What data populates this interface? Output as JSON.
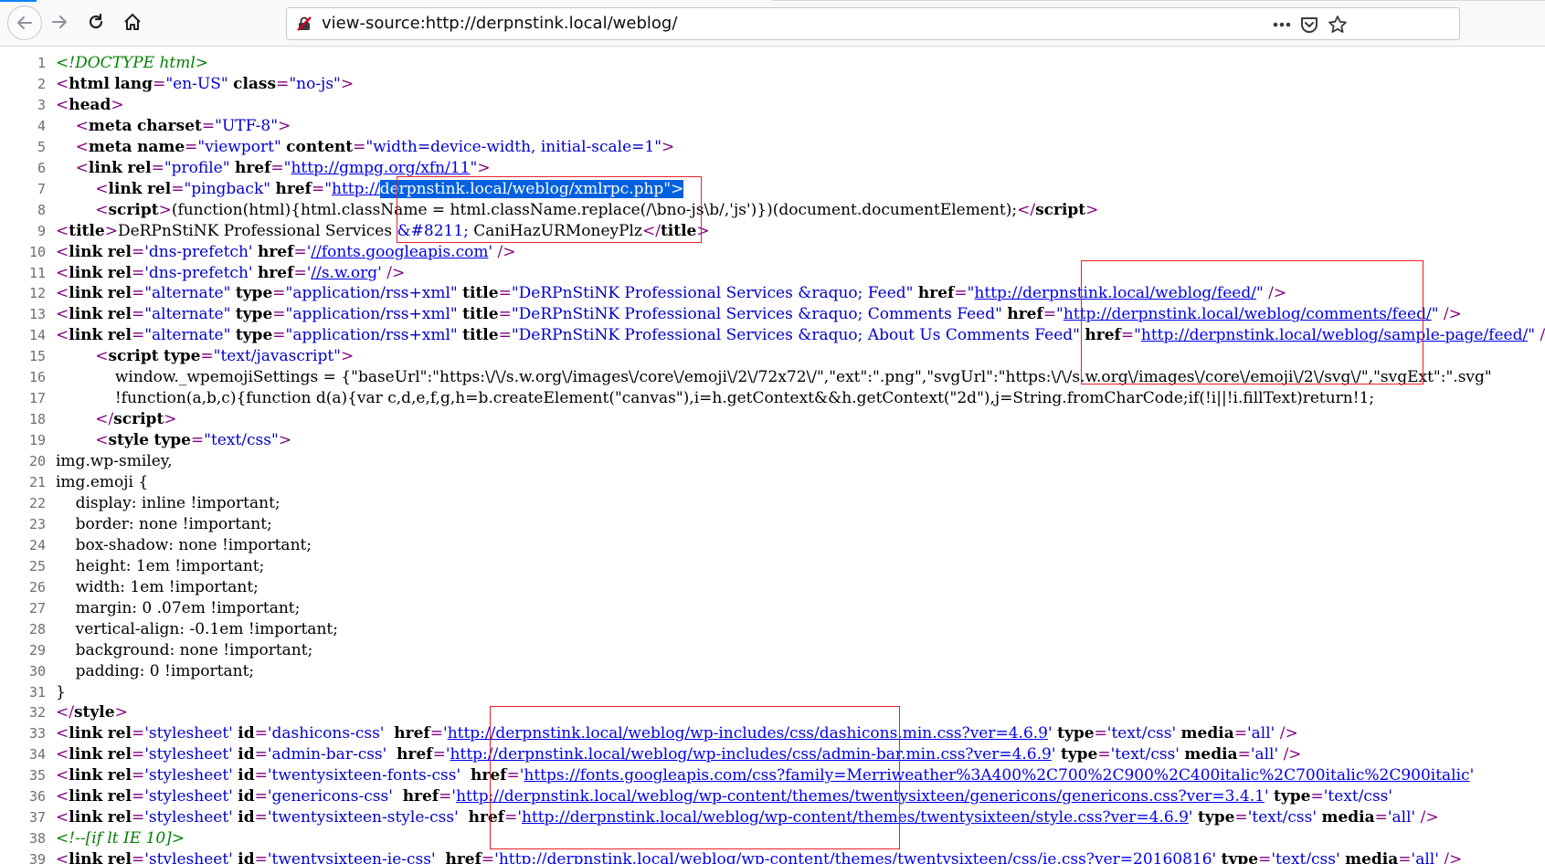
{
  "browser": {
    "url": "view-source:http://derpnstink.local/weblog/",
    "nav_icons": [
      "back-arrow-icon",
      "forward-arrow-icon",
      "reload-icon",
      "home-icon"
    ],
    "url_icons": [
      "insecure-connection-icon",
      "more-actions-icon",
      "pocket-icon",
      "bookmark-star-icon"
    ]
  },
  "source_lines": [
    {
      "n": "1",
      "html": "<span class='cm'>&lt;!DOCTYPE html&gt;</span>"
    },
    {
      "n": "2",
      "html": "<span class='t'>&lt;<span class='a'>html</span> <span class='a'>lang</span>=<span class='v'>\"en-US\"</span> <span class='a'>class</span>=<span class='v'>\"no-js\"</span>&gt;</span>"
    },
    {
      "n": "3",
      "html": "<span class='t'>&lt;<span class='a'>head</span>&gt;</span>"
    },
    {
      "n": "4",
      "html": "    <span class='t'>&lt;<span class='a'>meta</span> <span class='a'>charset</span>=<span class='v'>\"UTF-8\"</span>&gt;</span>"
    },
    {
      "n": "5",
      "html": "    <span class='t'>&lt;<span class='a'>meta</span> <span class='a'>name</span>=<span class='v'>\"viewport\"</span> <span class='a'>content</span>=<span class='v'>\"width=device-width, initial-scale=1\"</span>&gt;</span>"
    },
    {
      "n": "6",
      "html": "    <span class='t'>&lt;<span class='a'>link</span> <span class='a'>rel</span>=<span class='v'>\"profile\"</span> <span class='a'>href</span>=<span class='v'>\"<span class='u'>http://gmpg.org/xfn/11</span>\"</span>&gt;</span>"
    },
    {
      "n": "7",
      "html": "        <span class='t'>&lt;<span class='a'>link</span> <span class='a'>rel</span>=<span class='v'>\"pingback\"</span> <span class='a'>href</span>=<span class='v'>\"<span class='u'>http://</span><span class='sel'>derpnstink.local/weblog/xmlrpc.php\"&gt;</span></span></span>"
    },
    {
      "n": "8",
      "html": "        <span class='t'>&lt;<span class='a'>script</span>&gt;</span>(function(html){html.className = html.className.replace(/\\bno-js\\b/,'js')})(document.documentElement);<span class='t'>&lt;/<span class='a'>script</span>&gt;</span>"
    },
    {
      "n": "9",
      "html": "<span class='t'>&lt;<span class='a'>title</span>&gt;</span>DeRPnStiNK Professional Services <span class='v'>&amp;#8211;</span> CaniHazURMoneyPlz<span class='t'>&lt;/<span class='a'>title</span>&gt;</span>"
    },
    {
      "n": "10",
      "html": "<span class='t'>&lt;<span class='a'>link</span> <span class='a'>rel</span>=<span class='v'>'dns-prefetch'</span> <span class='a'>href</span>=<span class='v'>'<span class='u'>//fonts.googleapis.com</span>'</span> /&gt;</span>"
    },
    {
      "n": "11",
      "html": "<span class='t'>&lt;<span class='a'>link</span> <span class='a'>rel</span>=<span class='v'>'dns-prefetch'</span> <span class='a'>href</span>=<span class='v'>'<span class='u'>//s.w.org</span>'</span> /&gt;</span>"
    },
    {
      "n": "12",
      "html": "<span class='t'>&lt;<span class='a'>link</span> <span class='a'>rel</span>=<span class='v'>\"alternate\"</span> <span class='a'>type</span>=<span class='v'>\"application/rss+xml\"</span> <span class='a'>title</span>=<span class='v'>\"DeRPnStiNK Professional Services &amp;raquo; Feed\"</span> <span class='a'>href</span>=<span class='v'>\"<span class='u'>http://derpnstink.local/weblog/feed/</span>\"</span> /&gt;</span>"
    },
    {
      "n": "13",
      "html": "<span class='t'>&lt;<span class='a'>link</span> <span class='a'>rel</span>=<span class='v'>\"alternate\"</span> <span class='a'>type</span>=<span class='v'>\"application/rss+xml\"</span> <span class='a'>title</span>=<span class='v'>\"DeRPnStiNK Professional Services &amp;raquo; Comments Feed\"</span> <span class='a'>href</span>=<span class='v'>\"<span class='u'>http://derpnstink.local/weblog/comments/feed/</span>\"</span> /&gt;</span>"
    },
    {
      "n": "14",
      "html": "<span class='t'>&lt;<span class='a'>link</span> <span class='a'>rel</span>=<span class='v'>\"alternate\"</span> <span class='a'>type</span>=<span class='v'>\"application/rss+xml\"</span> <span class='a'>title</span>=<span class='v'>\"DeRPnStiNK Professional Services &amp;raquo; About Us Comments Feed\"</span> <span class='a'>href</span>=<span class='v'>\"<span class='u'>http://derpnstink.local/weblog/sample-page/feed/</span>\"</span> /&gt;</span>"
    },
    {
      "n": "15",
      "html": "        <span class='t'>&lt;<span class='a'>script</span> <span class='a'>type</span>=<span class='v'>\"text/javascript\"</span>&gt;</span>"
    },
    {
      "n": "16",
      "html": "            window._wpemojiSettings = {\"baseUrl\":\"https:\\/\\/s.w.org\\/images\\/core\\/emoji\\/2\\/72x72\\/\",\"ext\":\".png\",\"svgUrl\":\"https:\\/\\/s.w.org\\/images\\/core\\/emoji\\/2\\/svg\\/\",\"svgExt\":\".svg\""
    },
    {
      "n": "17",
      "html": "            !function(a,b,c){function d(a){var c,d,e,f,g,h=b.createElement(\"canvas\"),i=h.getContext&amp;&amp;h.getContext(\"2d\"),j=String.fromCharCode;if(!i||!i.fillText)return!1;"
    },
    {
      "n": "18",
      "html": "        <span class='t'>&lt;/<span class='a'>script</span>&gt;</span>"
    },
    {
      "n": "19",
      "html": "        <span class='t'>&lt;<span class='a'>style</span> <span class='a'>type</span>=<span class='v'>\"text/css\"</span>&gt;</span>"
    },
    {
      "n": "20",
      "html": "img.wp-smiley,"
    },
    {
      "n": "21",
      "html": "img.emoji {"
    },
    {
      "n": "22",
      "html": "    display: inline !important;"
    },
    {
      "n": "23",
      "html": "    border: none !important;"
    },
    {
      "n": "24",
      "html": "    box-shadow: none !important;"
    },
    {
      "n": "25",
      "html": "    height: 1em !important;"
    },
    {
      "n": "26",
      "html": "    width: 1em !important;"
    },
    {
      "n": "27",
      "html": "    margin: 0 .07em !important;"
    },
    {
      "n": "28",
      "html": "    vertical-align: -0.1em !important;"
    },
    {
      "n": "29",
      "html": "    background: none !important;"
    },
    {
      "n": "30",
      "html": "    padding: 0 !important;"
    },
    {
      "n": "31",
      "html": "}"
    },
    {
      "n": "32",
      "html": "<span class='t'>&lt;/<span class='a'>style</span>&gt;</span>"
    },
    {
      "n": "33",
      "html": "<span class='t'>&lt;<span class='a'>link</span> <span class='a'>rel</span>=<span class='v'>'stylesheet'</span> <span class='a'>id</span>=<span class='v'>'dashicons-css'</span>  <span class='a'>href</span>=<span class='v'>'<span class='u'>http://derpnstink.local/weblog/wp-includes/css/dashicons.min.css?ver=4.6.9</span>'</span> <span class='a'>type</span>=<span class='v'>'text/css'</span> <span class='a'>media</span>=<span class='v'>'all'</span> /&gt;</span>"
    },
    {
      "n": "34",
      "html": "<span class='t'>&lt;<span class='a'>link</span> <span class='a'>rel</span>=<span class='v'>'stylesheet'</span> <span class='a'>id</span>=<span class='v'>'admin-bar-css'</span>  <span class='a'>href</span>=<span class='v'>'<span class='u'>http://derpnstink.local/weblog/wp-includes/css/admin-bar.min.css?ver=4.6.9</span>'</span> <span class='a'>type</span>=<span class='v'>'text/css'</span> <span class='a'>media</span>=<span class='v'>'all'</span> /&gt;</span>"
    },
    {
      "n": "35",
      "html": "<span class='t'>&lt;<span class='a'>link</span> <span class='a'>rel</span>=<span class='v'>'stylesheet'</span> <span class='a'>id</span>=<span class='v'>'twentysixteen-fonts-css'</span>  <span class='a'>href</span>=<span class='v'>'<span class='u'>https://fonts.googleapis.com/css?family=Merriweather%3A400%2C700%2C900%2C400italic%2C700italic%2C900italic</span>'</span></span>"
    },
    {
      "n": "36",
      "html": "<span class='t'>&lt;<span class='a'>link</span> <span class='a'>rel</span>=<span class='v'>'stylesheet'</span> <span class='a'>id</span>=<span class='v'>'genericons-css'</span>  <span class='a'>href</span>=<span class='v'>'<span class='u'>http://derpnstink.local/weblog/wp-content/themes/twentysixteen/genericons/genericons.css?ver=3.4.1</span>'</span> <span class='a'>type</span>=<span class='v'>'text/css'</span></span>"
    },
    {
      "n": "37",
      "html": "<span class='t'>&lt;<span class='a'>link</span> <span class='a'>rel</span>=<span class='v'>'stylesheet'</span> <span class='a'>id</span>=<span class='v'>'twentysixteen-style-css'</span>  <span class='a'>href</span>=<span class='v'>'<span class='u'>http://derpnstink.local/weblog/wp-content/themes/twentysixteen/style.css?ver=4.6.9</span>'</span> <span class='a'>type</span>=<span class='v'>'text/css'</span> <span class='a'>media</span>=<span class='v'>'all'</span> /&gt;</span>"
    },
    {
      "n": "38",
      "html": "<span class='cm'>&lt;!--[if lt IE 10]&gt;</span>"
    },
    {
      "n": "39",
      "html": "<span class='t'>&lt;<span class='a'>link</span> <span class='a'>rel</span>=<span class='v'>'stylesheet'</span> <span class='a'>id</span>=<span class='v'>'twentysixteen-ie-css'</span>  <span class='a'>href</span>=<span class='v'>'<span class='u'>http://derpnstink.local/weblog/wp-content/themes/twentysixteen/css/ie.css?ver=20160816</span>'</span> <span class='a'>type</span>=<span class='v'>'text/css'</span> <span class='a'>media</span>=<span class='v'>'all'</span> /&gt;</span>"
    }
  ],
  "annotation_colors": {
    "highlight_box": "#e8202a",
    "selection": "#0060df"
  }
}
